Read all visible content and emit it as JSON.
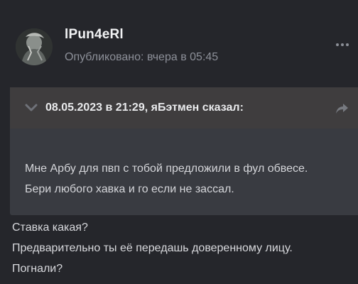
{
  "post": {
    "author": "lPun4eRl",
    "published_label": "Опубликовано:",
    "published_time": "вчера в 05:45",
    "more_icon": "ellipsis-icon",
    "avatar_icon": "user-avatar"
  },
  "quote": {
    "citation": "08.05.2023 в 21:29, яБэтмен сказал:",
    "toggle_icon": "chevron-down-icon",
    "jump_icon": "share-arrow-icon",
    "text": "Мне Арбу для пвп с тобой предложили в фул обвесе. Бери любого хавка и го если не зассал."
  },
  "body": {
    "lines": [
      "Ставка какая?",
      "Предварительно ты её передашь доверенному лицу.",
      "Погнали?"
    ]
  },
  "colors": {
    "background": "#25262b",
    "quote_background": "#393b41",
    "quote_header_background": "#3f3d3e",
    "muted_text": "#8d9099"
  }
}
